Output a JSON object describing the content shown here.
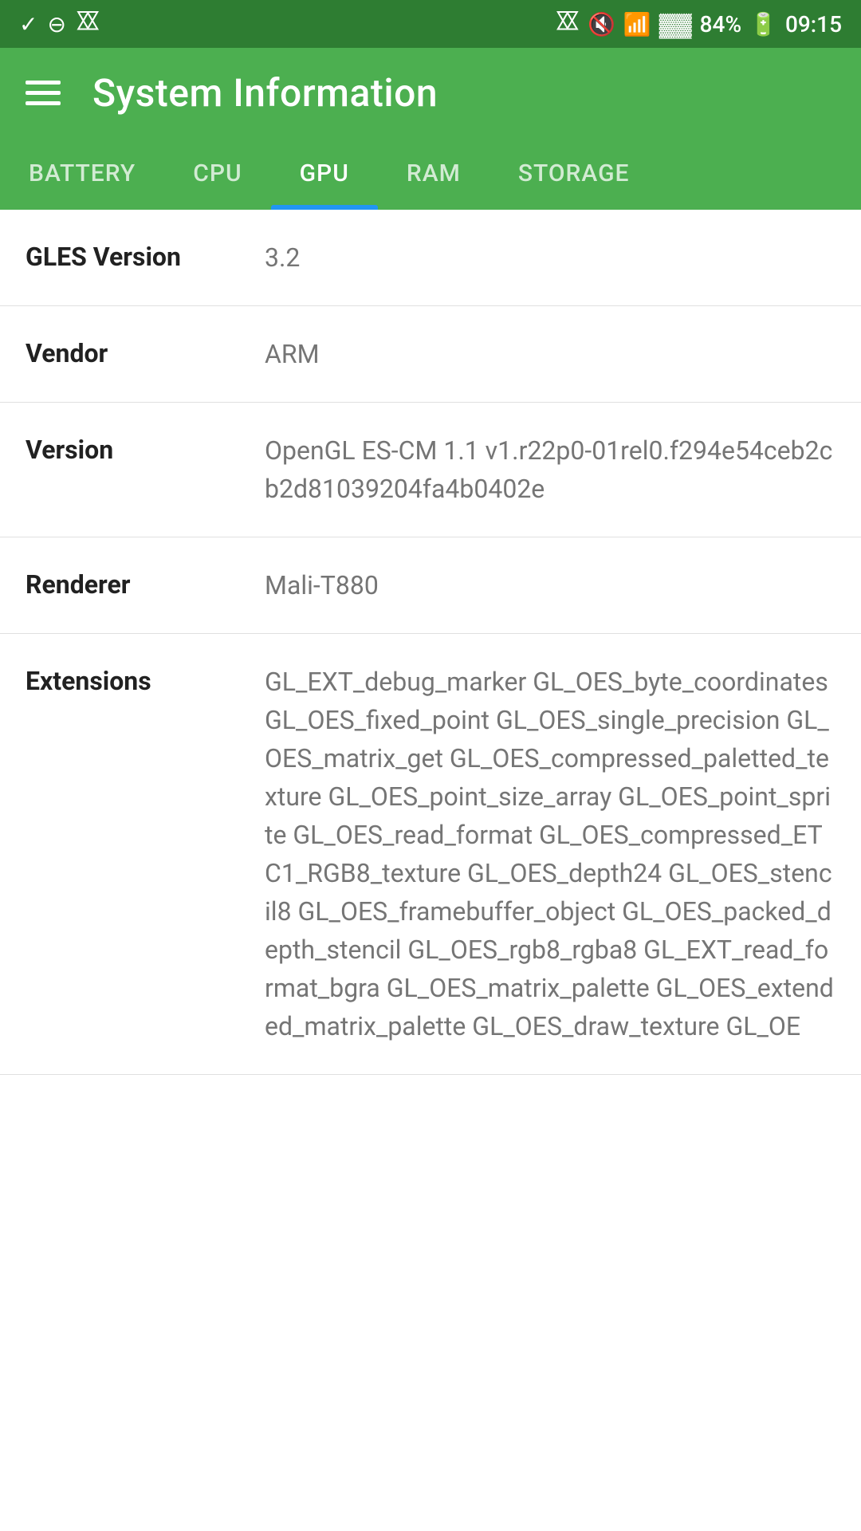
{
  "statusBar": {
    "battery": "84%",
    "time": "09:15",
    "icons": [
      "bluetooth",
      "volume-mute",
      "wifi",
      "signal",
      "battery-charging"
    ]
  },
  "toolbar": {
    "title": "System Information",
    "menuLabel": "Menu"
  },
  "tabs": [
    {
      "id": "battery",
      "label": "BATTERY",
      "active": false
    },
    {
      "id": "cpu",
      "label": "CPU",
      "active": false
    },
    {
      "id": "gpu",
      "label": "GPU",
      "active": true
    },
    {
      "id": "ram",
      "label": "RAM",
      "active": false
    },
    {
      "id": "storage",
      "label": "STORAGE",
      "active": false
    }
  ],
  "gpuInfo": [
    {
      "id": "gles-version",
      "label": "GLES Version",
      "value": "3.2"
    },
    {
      "id": "vendor",
      "label": "Vendor",
      "value": "ARM"
    },
    {
      "id": "version",
      "label": "Version",
      "value": "OpenGL ES-CM 1.1 v1.r22p0-01rel0.f294e54ceb2cb2d81039204fa4b0402e"
    },
    {
      "id": "renderer",
      "label": "Renderer",
      "value": "Mali-T880"
    },
    {
      "id": "extensions",
      "label": "Extensions",
      "value": "GL_EXT_debug_marker GL_OES_byte_coordinates GL_OES_fixed_point GL_OES_single_precision GL_OES_matrix_get GL_OES_compressed_paletted_texture GL_OES_point_size_array GL_OES_point_sprite GL_OES_read_format GL_OES_compressed_ETC1_RGB8_texture GL_OES_depth24 GL_OES_stencil8 GL_OES_framebuffer_object GL_OES_packed_depth_stencil GL_OES_rgb8_rgba8 GL_EXT_read_format_bgra GL_OES_matrix_palette GL_OES_extended_matrix_palette GL_OES_draw_texture GL_OE"
    }
  ]
}
